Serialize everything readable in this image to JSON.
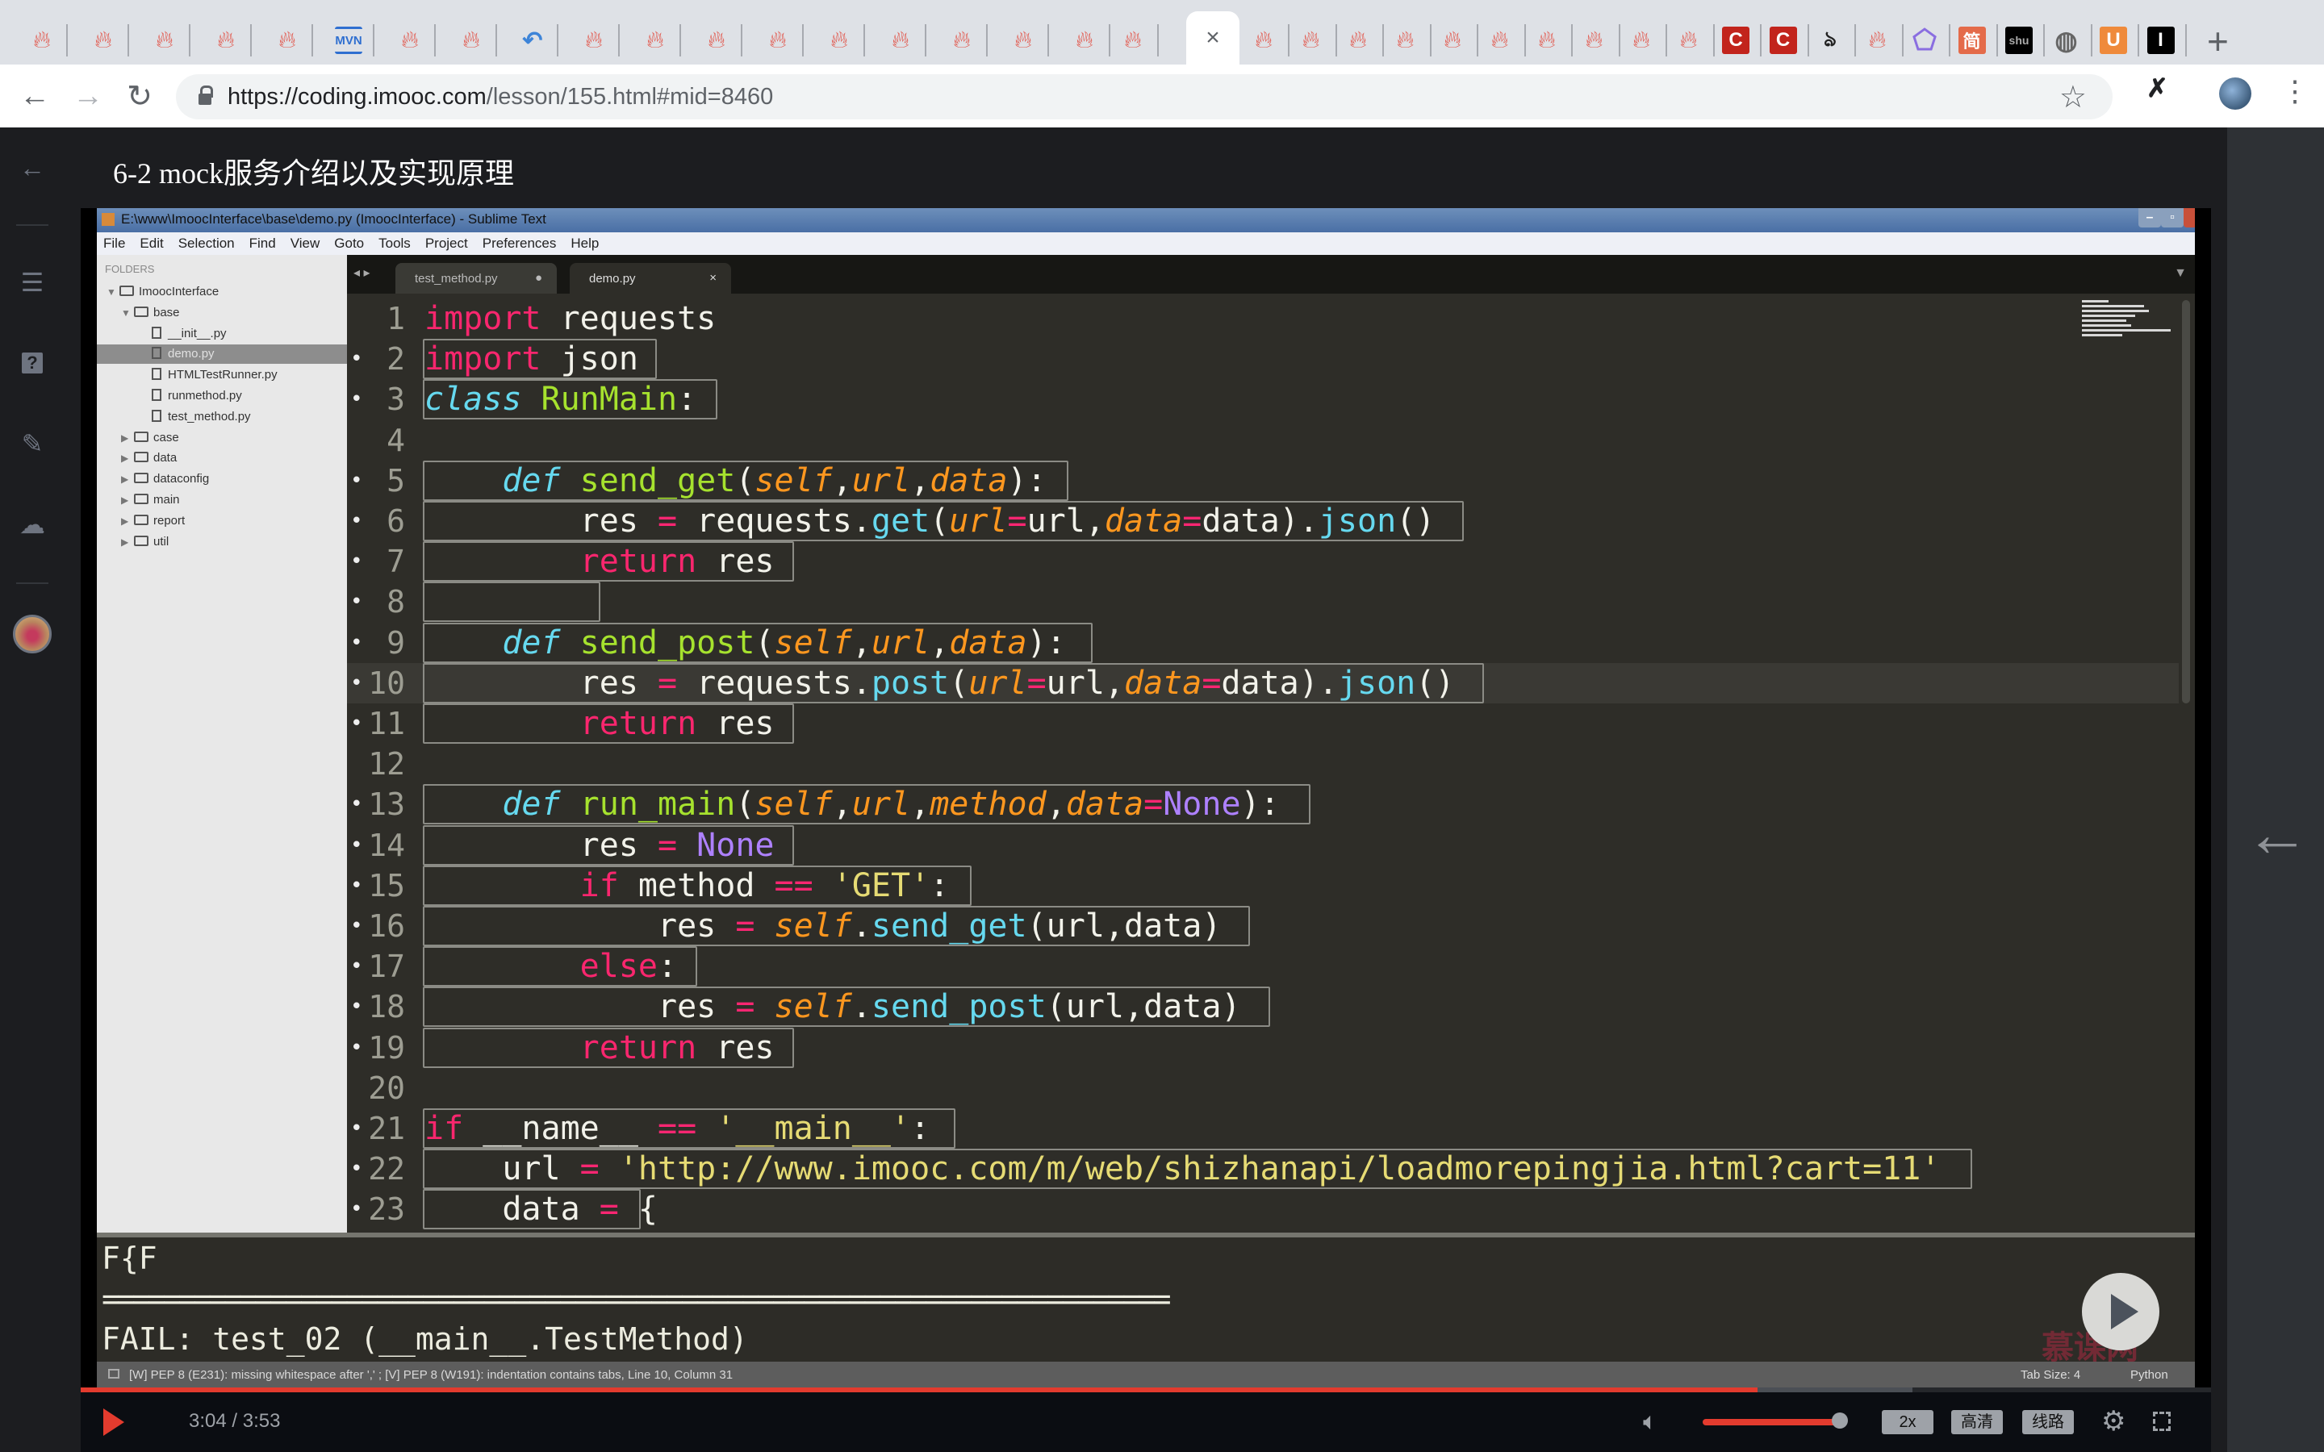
{
  "browser": {
    "tabs": {
      "favicons_left": [
        "flame",
        "flame",
        "flame",
        "flame",
        "flame",
        "mvn",
        "flame",
        "flame",
        "undo-blue",
        "flame",
        "flame",
        "flame",
        "flame",
        "flame",
        "flame",
        "flame",
        "flame",
        "flame",
        "flame"
      ],
      "active_tab_close": "×",
      "favicons_right": [
        "flame",
        "flame",
        "flame",
        "flame",
        "flame",
        "flame",
        "flame",
        "flame",
        "flame",
        "flame",
        "c-red",
        "c-red",
        "ninja",
        "flame",
        "pentagon",
        "jian",
        "shu",
        "globe",
        "u-orange",
        "i-black"
      ],
      "new_tab": "+"
    },
    "url": {
      "host": "https://coding.imooc.com",
      "path": "/lesson/155.html#mid=8460"
    },
    "extension_glyph": "✗"
  },
  "page": {
    "title": "6-2 mock服务介绍以及实现原理",
    "sidebar": [
      "back-icon",
      "list-icon",
      "question-icon",
      "pencil-icon",
      "cloud-check-icon",
      "avatar"
    ]
  },
  "sublime": {
    "window_title": "E:\\www\\ImoocInterface\\base\\demo.py (ImoocInterface) - Sublime Text",
    "menu": [
      "File",
      "Edit",
      "Selection",
      "Find",
      "View",
      "Goto",
      "Tools",
      "Project",
      "Preferences",
      "Help"
    ],
    "folders_header": "FOLDERS",
    "tree": [
      {
        "label": "ImoocInterface",
        "type": "folder-open",
        "level": 0
      },
      {
        "label": "base",
        "type": "folder-open",
        "level": 1
      },
      {
        "label": "__init__.py",
        "type": "file",
        "level": 2
      },
      {
        "label": "demo.py",
        "type": "file",
        "level": 2,
        "selected": true
      },
      {
        "label": "HTMLTestRunner.py",
        "type": "file",
        "level": 2
      },
      {
        "label": "runmethod.py",
        "type": "file",
        "level": 2
      },
      {
        "label": "test_method.py",
        "type": "file",
        "level": 2
      },
      {
        "label": "case",
        "type": "folder",
        "level": 1
      },
      {
        "label": "data",
        "type": "folder",
        "level": 1
      },
      {
        "label": "dataconfig",
        "type": "folder",
        "level": 1
      },
      {
        "label": "main",
        "type": "folder",
        "level": 1
      },
      {
        "label": "report",
        "type": "folder",
        "level": 1
      },
      {
        "label": "util",
        "type": "folder",
        "level": 1
      }
    ],
    "tabs": [
      {
        "label": "test_method.py",
        "marker": "●"
      },
      {
        "label": "demo.py",
        "marker": "×"
      }
    ],
    "code_lines": [
      "1",
      "2",
      "3",
      "4",
      "5",
      "6",
      "7",
      "8",
      "9",
      "10",
      "11",
      "12",
      "13",
      "14",
      "15",
      "16",
      "17",
      "18",
      "19",
      "20",
      "21",
      "22",
      "23"
    ],
    "console": {
      "line1": "F{F",
      "line2": "======================================================================",
      "line3": "FAIL: test_02 (__main__.TestMethod)"
    },
    "status": {
      "message": "[W] PEP 8 (E231): missing whitespace after ',' ; [V] PEP 8 (W191): indentation contains tabs, Line 10, Column 31",
      "tab_size": "Tab Size: 4",
      "syntax": "Python"
    },
    "watermark": "慕课网"
  },
  "player": {
    "time": "3:04 / 3:53",
    "progress_played": 0.787,
    "progress_buffered": 0.86,
    "volume": 1.0,
    "speed_label": "2x",
    "quality_label": "高清",
    "route_label": "线路"
  }
}
